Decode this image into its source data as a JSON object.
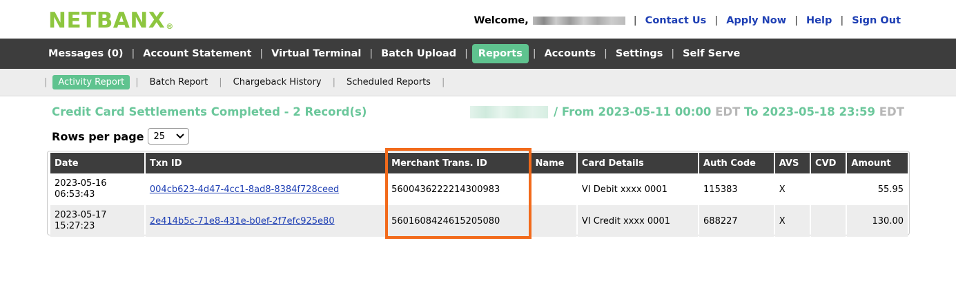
{
  "brand": {
    "name": "NETBANX",
    "reg": "®"
  },
  "header": {
    "welcome": "Welcome,",
    "links": [
      "Contact Us",
      "Apply Now",
      "Help",
      "Sign Out"
    ]
  },
  "mainnav": {
    "items": [
      "Messages (0)",
      "Account Statement",
      "Virtual Terminal",
      "Batch Upload",
      "Reports",
      "Accounts",
      "Settings",
      "Self Serve"
    ],
    "active": "Reports"
  },
  "subnav": {
    "items": [
      "Activity Report",
      "Batch Report",
      "Chargeback History",
      "Scheduled Reports"
    ],
    "active": "Activity Report"
  },
  "report": {
    "title": "Credit Card Settlements Completed - 2 Record(s)",
    "range_prefix": "/ From",
    "from": "2023-05-11 00:00",
    "tz": "EDT",
    "to_label": "To",
    "to": "2023-05-18 23:59"
  },
  "rows_per_page": {
    "label": "Rows per page",
    "value": "25"
  },
  "table": {
    "columns": [
      "Date",
      "Txn ID",
      "Merchant Trans. ID",
      "Name",
      "Card Details",
      "Auth Code",
      "AVS",
      "CVD",
      "Amount"
    ],
    "rows": [
      {
        "date": "2023-05-16",
        "time": "06:53:43",
        "txn_id": "004cb623-4d47-4cc1-8ad8-8384f728ceed",
        "merchant_id": "5600436222214300983",
        "name": "",
        "card": "VI Debit xxxx 0001",
        "auth": "115383",
        "avs": "X",
        "cvd": "",
        "amount": "55.95"
      },
      {
        "date": "2023-05-17",
        "time": "15:27:23",
        "txn_id": "2e414b5c-71e8-431e-b0ef-2f7efc925e80",
        "merchant_id": "5601608424615205080",
        "name": "",
        "card": "VI Credit xxxx 0001",
        "auth": "688227",
        "avs": "X",
        "cvd": "",
        "amount": "130.00"
      }
    ]
  },
  "colors": {
    "accent": "#5fc38f",
    "nav_bg": "#3d3d3d",
    "logo": "#8dc63f",
    "highlight": "#f26a1b",
    "link": "#1e3fb4"
  }
}
